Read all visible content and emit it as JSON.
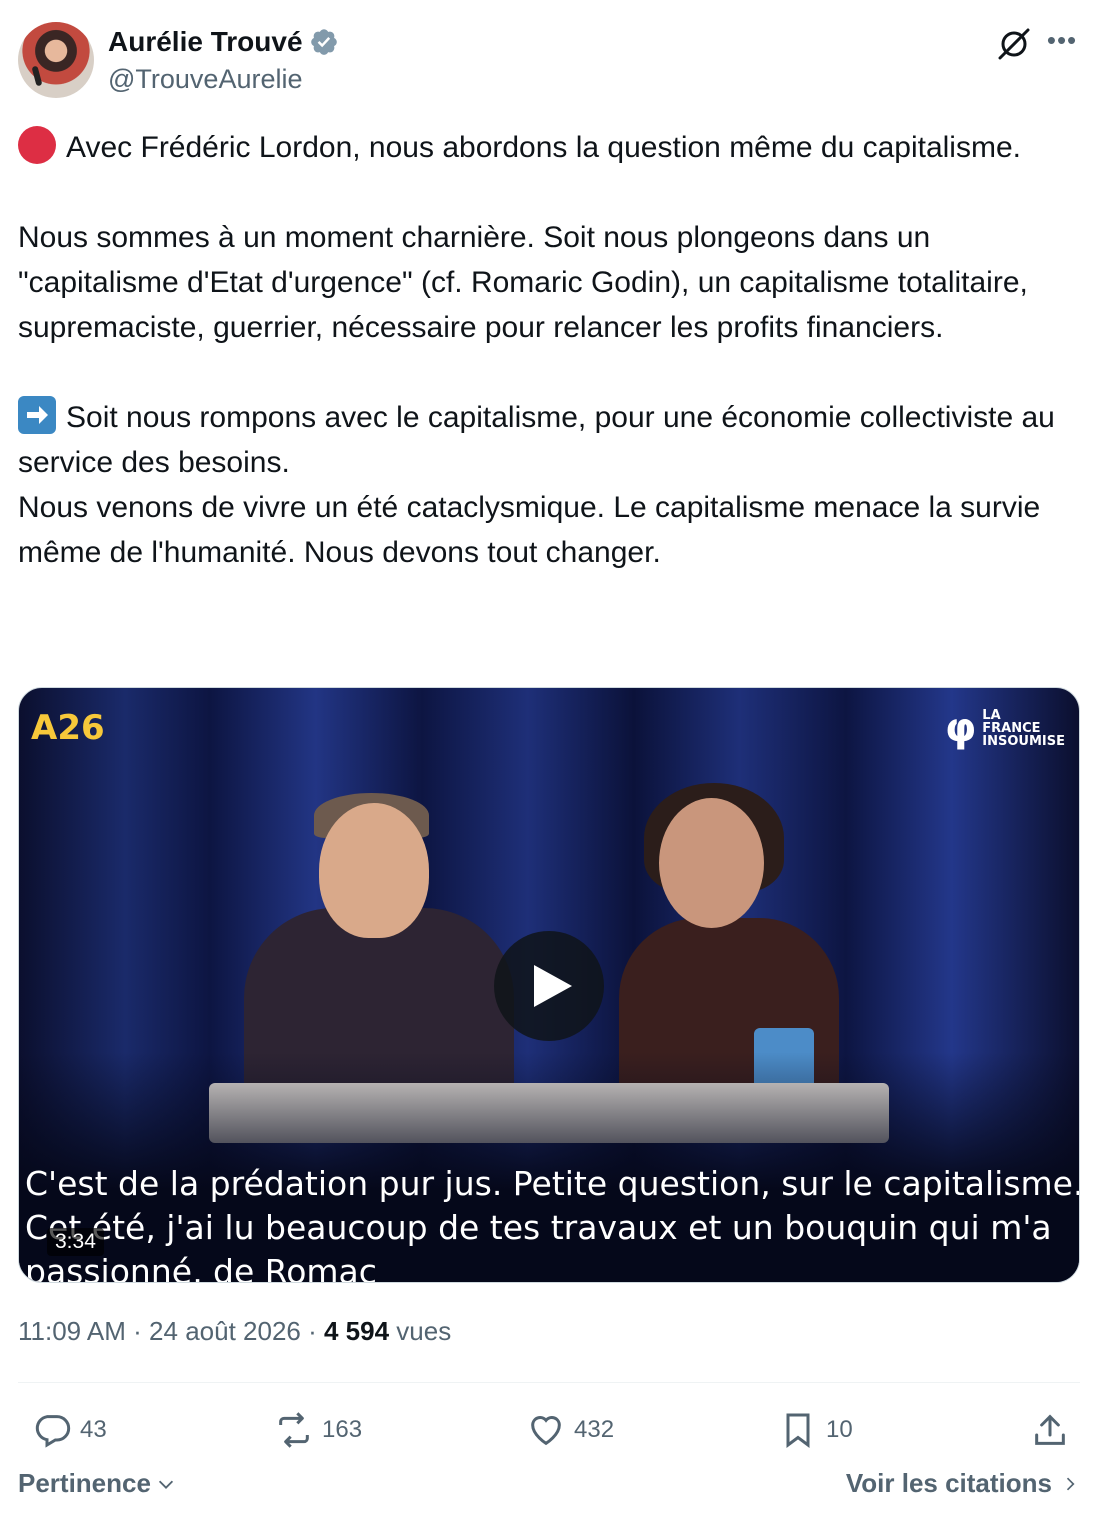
{
  "author": {
    "name": "Aurélie Trouvé",
    "handle": "@TrouveAurelie",
    "verified": true
  },
  "tweet": {
    "p1": "Avec Frédéric Lordon, nous abordons la question même du capitalisme.",
    "p2": "Nous sommes à un moment charnière. Soit nous plongeons dans un \"capitalisme d'Etat d'urgence\" (cf. Romaric Godin), un capitalisme totalitaire, supremaciste, guerrier, nécessaire pour relancer les profits financiers.",
    "p3": "Soit nous rompons avec le capitalisme, pour une économie collectiviste au service des besoins.",
    "p4": "Nous venons de vivre un été cataclysmique. Le capitalisme menace la survie même de l'humanité. Nous devons tout changer."
  },
  "video": {
    "subtitle_line1": "C'est de la prédation pur jus. Petite question, sur le capitalisme.",
    "subtitle_line2": "Cet été, j'ai lu beaucoup de tes travaux et un bouquin qui m'a",
    "subtitle_line3": "passionné, de Romac",
    "duration": "3:34",
    "logo_left": "A26",
    "logo_right_symbol": "φ",
    "logo_right_line1": "LA",
    "logo_right_line2": "FRANCE",
    "logo_right_line3": "INSOUMISE"
  },
  "meta": {
    "time": "11:09 AM",
    "separator": " · ",
    "date": "24 août 2026",
    "views_count": "4 594",
    "views_label": "vues"
  },
  "actions": {
    "replies": "43",
    "reposts": "163",
    "likes": "432",
    "bookmarks": "10"
  },
  "footer": {
    "sort_label": "Pertinence",
    "quotes_label": "Voir les citations"
  },
  "colors": {
    "text_primary": "#0f1419",
    "text_secondary": "#536471",
    "verified_blue": "#1d9bf0",
    "red_dot": "#dd2e44"
  }
}
